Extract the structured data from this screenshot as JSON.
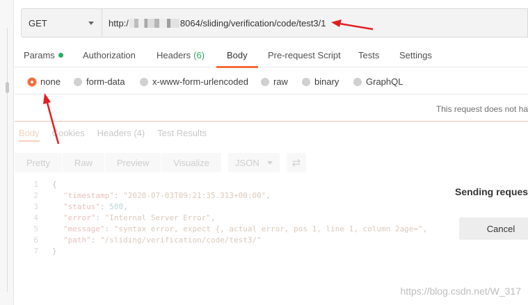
{
  "request": {
    "method": "GET",
    "url_prefix": "http:/",
    "url_suffix": "8064/sliding/verification/code/test3/1"
  },
  "tabs": [
    {
      "label": "Params",
      "indicator": "dot"
    },
    {
      "label": "Authorization"
    },
    {
      "label": "Headers",
      "count": "(6)"
    },
    {
      "label": "Body",
      "active": true
    },
    {
      "label": "Pre-request Script"
    },
    {
      "label": "Tests"
    },
    {
      "label": "Settings"
    }
  ],
  "body_types": [
    {
      "label": "none",
      "selected": true
    },
    {
      "label": "form-data"
    },
    {
      "label": "x-www-form-urlencoded"
    },
    {
      "label": "raw"
    },
    {
      "label": "binary"
    },
    {
      "label": "GraphQL"
    }
  ],
  "notice": "This request does not ha",
  "response_tabs": [
    "Body",
    "Cookies",
    "Headers (4)",
    "Test Results"
  ],
  "toolbar": {
    "buttons": [
      "Pretty",
      "Raw",
      "Preview",
      "Visualize"
    ],
    "format": "JSON"
  },
  "code_lines": [
    {
      "n": "1",
      "text": "{"
    },
    {
      "n": "2",
      "key": "\"timestamp\"",
      "value": "\"2020-07-03T09:21:35.313+00:00\"",
      "tail": ","
    },
    {
      "n": "3",
      "key": "\"status\"",
      "value": "500",
      "tail": ","
    },
    {
      "n": "4",
      "key": "\"error\"",
      "value": "\"Internal Server Error\"",
      "tail": ","
    },
    {
      "n": "5",
      "key": "\"message\"",
      "value": "\"syntax error, expect {, actual error, pos 1, line 1, column 2age=\"",
      "tail": ","
    },
    {
      "n": "6",
      "key": "\"path\"",
      "value": "\"/sliding/verification/code/test3/\"",
      "tail": ""
    },
    {
      "n": "7",
      "text": "}"
    }
  ],
  "overlay": {
    "title": "Sending reques",
    "cancel_label": "Cancel"
  },
  "watermark": "https://blog.csdn.net/W_317",
  "colors": {
    "accent": "#f26b3a",
    "annotation_arrow": "#e02020",
    "success": "#27ae60"
  },
  "icons": {
    "method_dropdown": "chevron-down-icon",
    "wrap_lines": "wrap-lines-icon"
  }
}
